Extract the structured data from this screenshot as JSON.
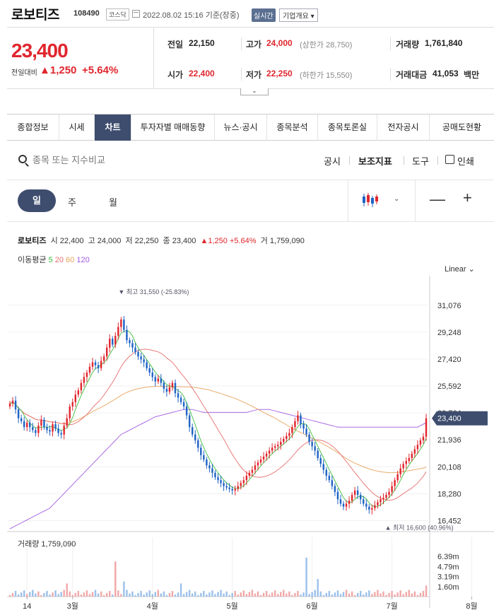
{
  "header": {
    "stock_name": "로보티즈",
    "stock_code": "108490",
    "market_badge": "코스닥",
    "datetime": "2022.08.02 15:16 기준(장중)",
    "realtime_badge": "실시간",
    "company_button": "기업개요"
  },
  "price": {
    "current": "23,400",
    "prev_label": "전일대비",
    "change": "▲1,250",
    "change_pct": "+5.64%"
  },
  "quote": {
    "prev_label": "전일",
    "prev_value": "22,150",
    "high_label": "고가",
    "high_value": "24,000",
    "upper_limit": "(상한가 28,750)",
    "volume_label": "거래량",
    "volume_value": "1,761,840",
    "open_label": "시가",
    "open_value": "22,400",
    "low_label": "저가",
    "low_value": "22,250",
    "lower_limit": "(하한가 15,550)",
    "amount_label": "거래대금",
    "amount_value": "41,053",
    "amount_unit": "백만"
  },
  "tabs": [
    "종합정보",
    "시세",
    "차트",
    "투자자별 매매동향",
    "뉴스·공시",
    "종목분석",
    "종목토론실",
    "전자공시",
    "공매도현황"
  ],
  "active_tab": 2,
  "toolbar": {
    "search_placeholder": "종목 또는 지수비교",
    "disclosure": "공시",
    "indicator": "보조지표",
    "tools": "도구",
    "print": "인쇄"
  },
  "periods": {
    "day": "일",
    "week": "주",
    "month": "월"
  },
  "info": {
    "name": "로보티즈",
    "open_label": "시",
    "open": "22,400",
    "high_label": "고",
    "high": "24,000",
    "low_label": "저",
    "low": "22,250",
    "close_label": "종",
    "close": "23,400",
    "change": "▲1,250 +5.64%",
    "vol_label": "거",
    "vol": "1,759,090"
  },
  "ma": {
    "label": "이동평균",
    "p5": "5",
    "p20": "20",
    "p60": "60",
    "p120": "120"
  },
  "scale_label": "Linear",
  "colors": {
    "up": "#e0262e",
    "down": "#1e63c4",
    "ma5": "#3bbd3b",
    "ma20": "#e56d6d",
    "ma60": "#e8a35b",
    "ma120": "#a25be0",
    "accent": "#3e4d6e"
  },
  "chart_data": {
    "type": "candlestick",
    "y_ticks": [
      "31,076",
      "29,248",
      "27,420",
      "25,592",
      "23,764",
      "21,936",
      "20,108",
      "18,280",
      "16,452"
    ],
    "y_tick_values": [
      31076,
      29248,
      27420,
      25592,
      23764,
      21936,
      20108,
      18280,
      16452
    ],
    "x_ticks": [
      "14",
      "3월",
      "4월",
      "5월",
      "6월",
      "7월",
      "8월"
    ],
    "x_tick_index": [
      6,
      22,
      50,
      78,
      106,
      134,
      162
    ],
    "ylim": [
      15900,
      32600
    ],
    "current_price": 23400,
    "current_label": "23,400",
    "max_label": "▼ 최고 31,550 (-25.83%)",
    "max_index": 39,
    "max_value": 31550,
    "min_label": "▲ 최저 16,600 (40.96%)",
    "min_index": 134,
    "min_value": 16600,
    "volume_title": "거래량 1,759,090",
    "volume_ticks": [
      "6.39m",
      "4.79m",
      "3.19m",
      "1.60m"
    ],
    "volume_tick_values": [
      6.39,
      4.79,
      3.19,
      1.6
    ],
    "close": [
      24400,
      24600,
      24000,
      23400,
      23200,
      22800,
      23100,
      22800,
      22600,
      22400,
      22900,
      23300,
      22800,
      22600,
      22500,
      23000,
      22700,
      22400,
      22300,
      22900,
      23400,
      24200,
      24500,
      25000,
      25300,
      25800,
      26200,
      26500,
      26900,
      27200,
      27000,
      26800,
      27300,
      27600,
      28200,
      28800,
      28400,
      29000,
      29600,
      30100,
      29400,
      28700,
      28500,
      28200,
      27900,
      27600,
      27400,
      27200,
      26800,
      26500,
      26200,
      25900,
      26100,
      25800,
      25400,
      25200,
      25500,
      25800,
      25100,
      24800,
      24500,
      24200,
      23600,
      22800,
      22300,
      21900,
      21400,
      20900,
      20600,
      20200,
      20000,
      19700,
      19400,
      19200,
      19000,
      18800,
      18700,
      18600,
      18500,
      18600,
      18800,
      19000,
      19200,
      19500,
      19700,
      19900,
      20200,
      20400,
      20600,
      20800,
      21000,
      21200,
      21400,
      21500,
      21600,
      21800,
      22000,
      22200,
      22400,
      22800,
      23200,
      23600,
      23000,
      22700,
      22300,
      21800,
      21500,
      21200,
      20700,
      20300,
      19900,
      19500,
      19200,
      18800,
      18400,
      17900,
      17600,
      17400,
      17600,
      17800,
      18200,
      18500,
      18200,
      17900,
      17600,
      17400,
      17200,
      17300,
      17500,
      17700,
      17900,
      18000,
      18200,
      18400,
      18800,
      19200,
      19600,
      20000,
      20300,
      20500,
      20700,
      21000,
      21300,
      21600,
      21900,
      22150,
      23400
    ],
    "ma120": [
      15900,
      16000,
      16100,
      16200,
      16300,
      16400,
      16500,
      16600,
      16700,
      16800,
      16900,
      17000,
      17100,
      17200,
      17300,
      17500,
      17700,
      17900,
      18100,
      18300,
      18500,
      18700,
      18900,
      19100,
      19300,
      19500,
      19700,
      19900,
      20100,
      20300,
      20500,
      20700,
      20900,
      21100,
      21300,
      21500,
      21700,
      21900,
      22100,
      22300,
      22400,
      22500,
      22600,
      22700,
      22800,
      22900,
      23000,
      23100,
      23200,
      23300,
      23400,
      23500,
      23550,
      23600,
      23650,
      23700,
      23750,
      23800,
      23850,
      23900,
      23950,
      24000,
      24000,
      24000,
      24000,
      23950,
      23900,
      23850,
      23800,
      23800,
      23800,
      23800,
      23800,
      23800,
      23800,
      23800,
      23800,
      23800,
      23800,
      23800,
      23800,
      23800,
      23800,
      23800,
      23850,
      23900,
      23950,
      24000,
      24000,
      24000,
      24000,
      24000,
      23950,
      23900,
      23850,
      23800,
      23750,
      23700,
      23650,
      23600,
      23550,
      23500,
      23450,
      23400,
      23350,
      23300,
      23250,
      23200,
      23150,
      23100,
      23050,
      23000,
      22950,
      22900,
      22850,
      22800,
      22800,
      22800,
      22800,
      22800,
      22800,
      22800,
      22800,
      22800,
      22800,
      22800,
      22800,
      22800,
      22800,
      22800,
      22800,
      22800,
      22800,
      22800,
      22800,
      22800,
      22800,
      22800,
      22800,
      22800,
      22800,
      22800,
      22800,
      22800,
      22900,
      23000,
      23100
    ]
  }
}
